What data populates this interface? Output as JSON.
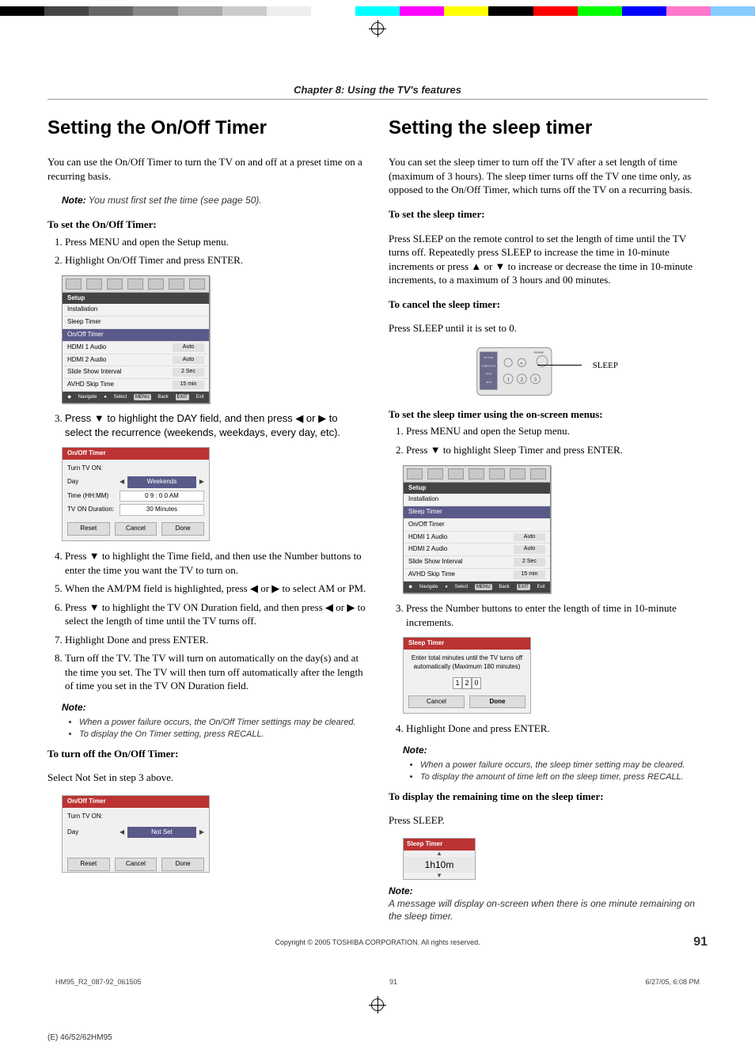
{
  "chapter": "Chapter 8: Using the TV's features",
  "left": {
    "h1": "Setting the On/Off Timer",
    "intro": "You can use the On/Off Timer to turn the TV on and off at a preset time on a recurring basis.",
    "note1_label": "Note:",
    "note1": " You must first set the time (see page 50).",
    "sub1": "To set the On/Off Timer:",
    "steps_a": [
      "Press MENU and open the Setup menu.",
      "Highlight On/Off Timer and press ENTER."
    ],
    "osd1": {
      "title": "Setup",
      "items": [
        {
          "label": "Installation",
          "val": ""
        },
        {
          "label": "Sleep Timer",
          "val": ""
        },
        {
          "label": "On/Off Timer",
          "val": "",
          "selected": true
        },
        {
          "label": "HDMI 1 Audio",
          "val": "Auto"
        },
        {
          "label": "HDMI 2 Audio",
          "val": "Auto"
        },
        {
          "label": "Slide Show Interval",
          "val": "2 Sec"
        },
        {
          "label": "AVHD Skip Time",
          "val": "15 min"
        }
      ],
      "foot": {
        "navigate": "Navigate",
        "select": "Select",
        "back": "Back",
        "exit": "Exit",
        "menu": "MENU",
        "exitbtn": "EXIT"
      }
    },
    "step3": "Press ▼ to highlight the DAY field, and then press ◀ or ▶ to select the recurrence (weekends, weekdays, every day, etc).",
    "panel1": {
      "title": "On/Off Timer",
      "turn_on": "Turn TV ON:",
      "rows": [
        {
          "label": "Day",
          "val": "Weekends",
          "sel": true
        },
        {
          "label": "Time (HH:MM)",
          "val": "0 9 : 0 0  AM"
        },
        {
          "label": "TV ON Duration:",
          "val": "30 Minutes"
        }
      ],
      "btns": [
        "Reset",
        "Cancel",
        "Done"
      ]
    },
    "step4": "Press ▼ to highlight the Time field, and then use the Number buttons to enter the time you want the TV to turn on.",
    "step5": "When the AM/PM field is highlighted, press ◀ or ▶ to select AM or PM.",
    "step6": "Press ▼ to highlight the TV ON Duration field, and then press ◀ or ▶ to select the length of time until the TV turns off.",
    "step7": "Highlight Done and press ENTER.",
    "step8": "Turn off the TV. The TV will turn on automatically on the day(s) and at the time you set. The TV will then turn off automatically after the length of time you set in the TV ON Duration field.",
    "note2_label": "Note:",
    "note2_bullets": [
      "When a power failure occurs, the On/Off Timer settings may be cleared.",
      "To display the On Timer setting, press RECALL."
    ],
    "sub2": "To turn off the On/Off Timer:",
    "turnoff_text": "Select Not Set in step 3 above.",
    "panel2": {
      "title": "On/Off Timer",
      "turn_on": "Turn TV ON:",
      "rows": [
        {
          "label": "Day",
          "val": "Not Set",
          "sel": true
        }
      ],
      "btns": [
        "Reset",
        "Cancel",
        "Done"
      ]
    }
  },
  "right": {
    "h1": "Setting the sleep timer",
    "intro": "You can set the sleep timer to turn off the TV after a set length of time (maximum of 3 hours). The sleep timer turns off the TV one time only, as opposed to the On/Off Timer, which turns off the TV on a recurring basis.",
    "sub1": "To set the sleep timer:",
    "set_para": "Press SLEEP on the remote control to set the length of time until the TV turns off. Repeatedly press SLEEP to increase the time in 10-minute increments or press ▲ or ▼ to increase or decrease the time in 10-minute increments, to a maximum of 3 hours and 00 minutes.",
    "sub2": "To cancel the sleep timer:",
    "cancel_para": "Press SLEEP until it is set to 0.",
    "remote": {
      "power": "POWER",
      "sleep": "SLEEP",
      "n1": "1",
      "n2": "2",
      "n3": "3",
      "tvvcr": "TV/VCR",
      "cable": "CABLE/SAT",
      "dvd": "DVD",
      "aux": "AUX",
      "input": "INPUT",
      "sleep_label": "SLEEP"
    },
    "sub3": "To set the sleep timer using the on-screen menus:",
    "steps_b": [
      "Press MENU and open the Setup menu.",
      "Press ▼ to highlight Sleep Timer and press ENTER."
    ],
    "osd2": {
      "title": "Setup",
      "items": [
        {
          "label": "Installation",
          "val": ""
        },
        {
          "label": "Sleep Timer",
          "val": "",
          "selected": true
        },
        {
          "label": "On/Off Timer",
          "val": ""
        },
        {
          "label": "HDMI 1 Audio",
          "val": "Auto"
        },
        {
          "label": "HDMI 2 Audio",
          "val": "Auto"
        },
        {
          "label": "Slide Show Interval",
          "val": "2 Sec"
        },
        {
          "label": "AVHD Skip Time",
          "val": "15 min"
        }
      ],
      "foot": {
        "navigate": "Navigate",
        "select": "Select",
        "back": "Back",
        "exit": "Exit",
        "menu": "MENU",
        "exitbtn": "EXIT"
      }
    },
    "step3": "Press the Number buttons to enter the length of time in 10-minute increments.",
    "sleep_panel": {
      "title": "Sleep Timer",
      "msg": "Enter total minutes until the TV turns off automatically (Maximum 180 minutes)",
      "digits": [
        "1",
        "2",
        "0"
      ],
      "btns": [
        "Cancel",
        "Done"
      ]
    },
    "step4": "Highlight Done and press ENTER.",
    "note_label": "Note:",
    "note_bullets": [
      "When a power failure occurs, the sleep timer setting may be cleared.",
      "To display the amount of time left on the sleep timer, press RECALL."
    ],
    "sub4": "To display the remaining time on the sleep timer:",
    "disp_para": "Press SLEEP.",
    "disp_panel": {
      "title": "Sleep Timer",
      "val": "1h10m"
    },
    "note2_label": "Note:",
    "note2": "A message will display on-screen when there is one minute remaining on the sleep timer."
  },
  "footer": {
    "copyright": "Copyright © 2005 TOSHIBA CORPORATION. All rights reserved.",
    "page": "91",
    "pf_left": "HM95_R2_087-92_061505",
    "pf_mid": "91",
    "pf_right": "6/27/05, 6:08 PM",
    "model": "(E) 46/52/62HM95"
  },
  "colorbar": [
    "#000",
    "#444",
    "#666",
    "#888",
    "#aaa",
    "#ccc",
    "#eee",
    "#fff",
    "#0ff",
    "#f0f",
    "#ff0",
    "#000",
    "#f00",
    "#0f0",
    "#00f",
    "#f7c",
    "#8cf"
  ]
}
